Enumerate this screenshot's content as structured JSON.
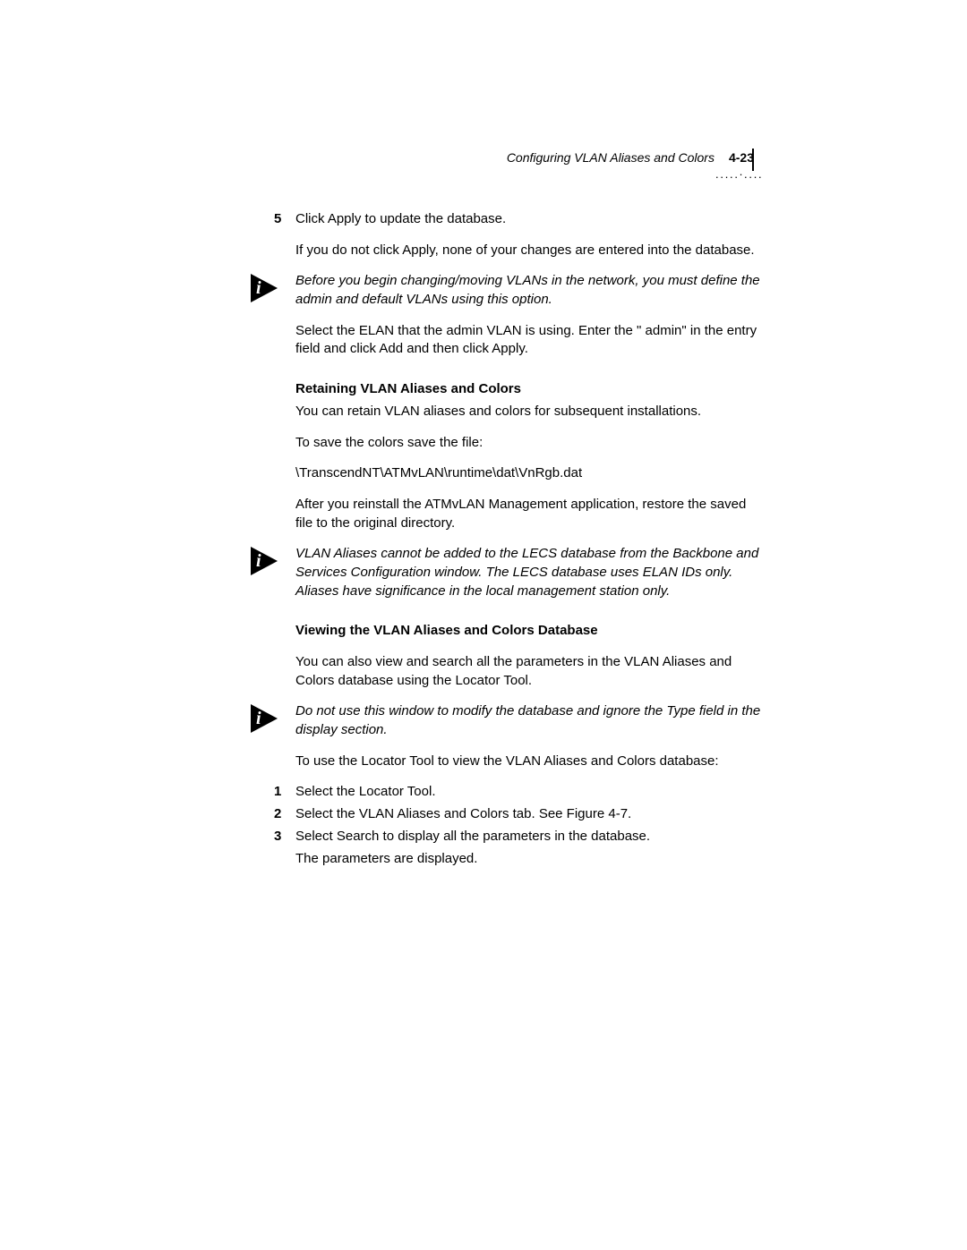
{
  "header": {
    "title": "Configuring VLAN Aliases and Colors",
    "page": "4-23"
  },
  "step5": {
    "num": "5",
    "line1": "Click Apply to update the database.",
    "line2": "If you do not click Apply, none of your changes are entered into the database."
  },
  "note1": "Before you begin changing/moving VLANs in the network, you must define the admin and default VLANs using this option.",
  "para_after_note1": "Select the ELAN that the admin VLAN is using. Enter the \" admin\" in the entry field and click Add and then click Apply.",
  "heading1": "Retaining VLAN Aliases and Colors",
  "retain_p1": "You can retain VLAN aliases and colors for subsequent installations.",
  "retain_p2": "To save the colors save the file:",
  "retain_path": "\\TranscendNT\\ATMvLAN\\runtime\\dat\\VnRgb.dat",
  "retain_p3": "After you reinstall the ATMvLAN Management application, restore the saved file to the original directory.",
  "note2": "VLAN Aliases cannot be added to the LECS database from the Backbone and Services Configuration window. The LECS database uses ELAN IDs only. Aliases have significance in the local management station only.",
  "heading2": "Viewing the VLAN Aliases and Colors Database",
  "view_p1": "You can also view and search all the parameters in the VLAN Aliases and Colors database using the Locator Tool.",
  "note3": "Do not use this window to modify the database and ignore the Type field in the display section.",
  "view_p2": "To use the Locator Tool to view the VLAN Aliases and Colors database:",
  "steps": {
    "s1_num": "1",
    "s1": "Select the Locator Tool.",
    "s2_num": "2",
    "s2": "Select the VLAN Aliases and Colors tab. See Figure 4-7.",
    "s3_num": "3",
    "s3": "Select Search to display all the parameters in the database.",
    "s3b": "The parameters are displayed."
  }
}
